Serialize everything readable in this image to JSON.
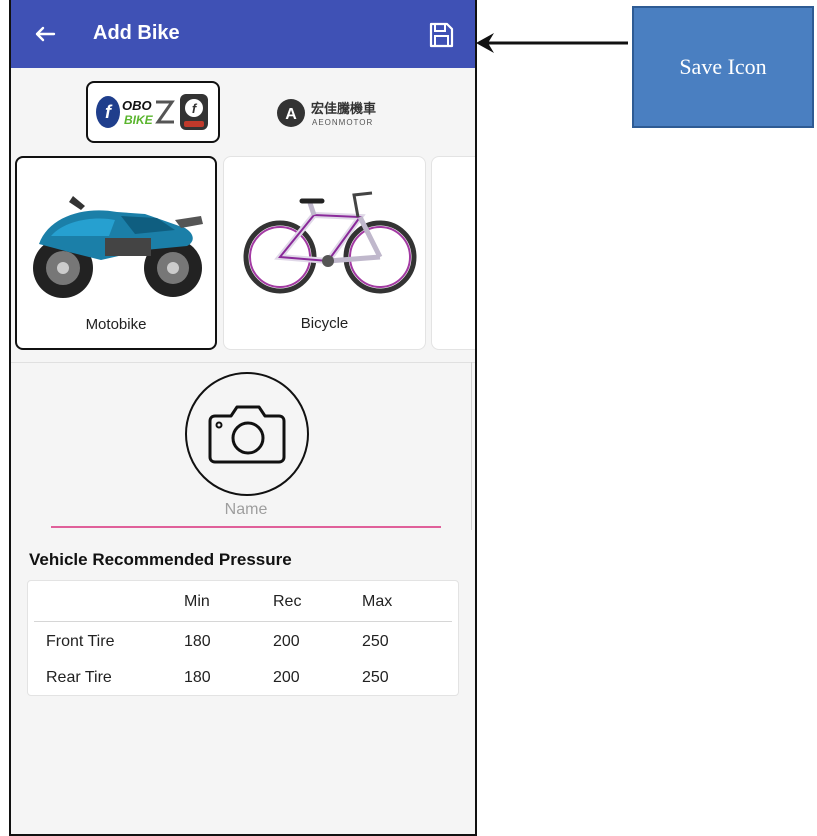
{
  "appbar": {
    "title": "Add Bike",
    "back_icon": "arrow-left-icon",
    "save_icon": "floppy-disk-icon",
    "color": "#3f51b5"
  },
  "brands": [
    {
      "label": "fOBO BIKE 2",
      "selected": true
    },
    {
      "label": "宏佳騰機車 AEONMOTOR",
      "selected": false
    }
  ],
  "vehicle_types": [
    {
      "label": "Motobike",
      "selected": true
    },
    {
      "label": "Bicycle",
      "selected": false
    }
  ],
  "photo": {
    "icon": "camera-icon"
  },
  "name_field": {
    "placeholder": "Name",
    "value": "",
    "underline_color": "#e0609a"
  },
  "pressure": {
    "title": "Vehicle Recommended Pressure",
    "headers": [
      "",
      "Min",
      "Rec",
      "Max"
    ],
    "rows": [
      {
        "label": "Front Tire",
        "min": "180",
        "rec": "200",
        "max": "250"
      },
      {
        "label": "Rear Tire",
        "min": "180",
        "rec": "200",
        "max": "250"
      }
    ]
  },
  "annotation": {
    "label": "Save Icon",
    "color": "#4a7fc1"
  }
}
